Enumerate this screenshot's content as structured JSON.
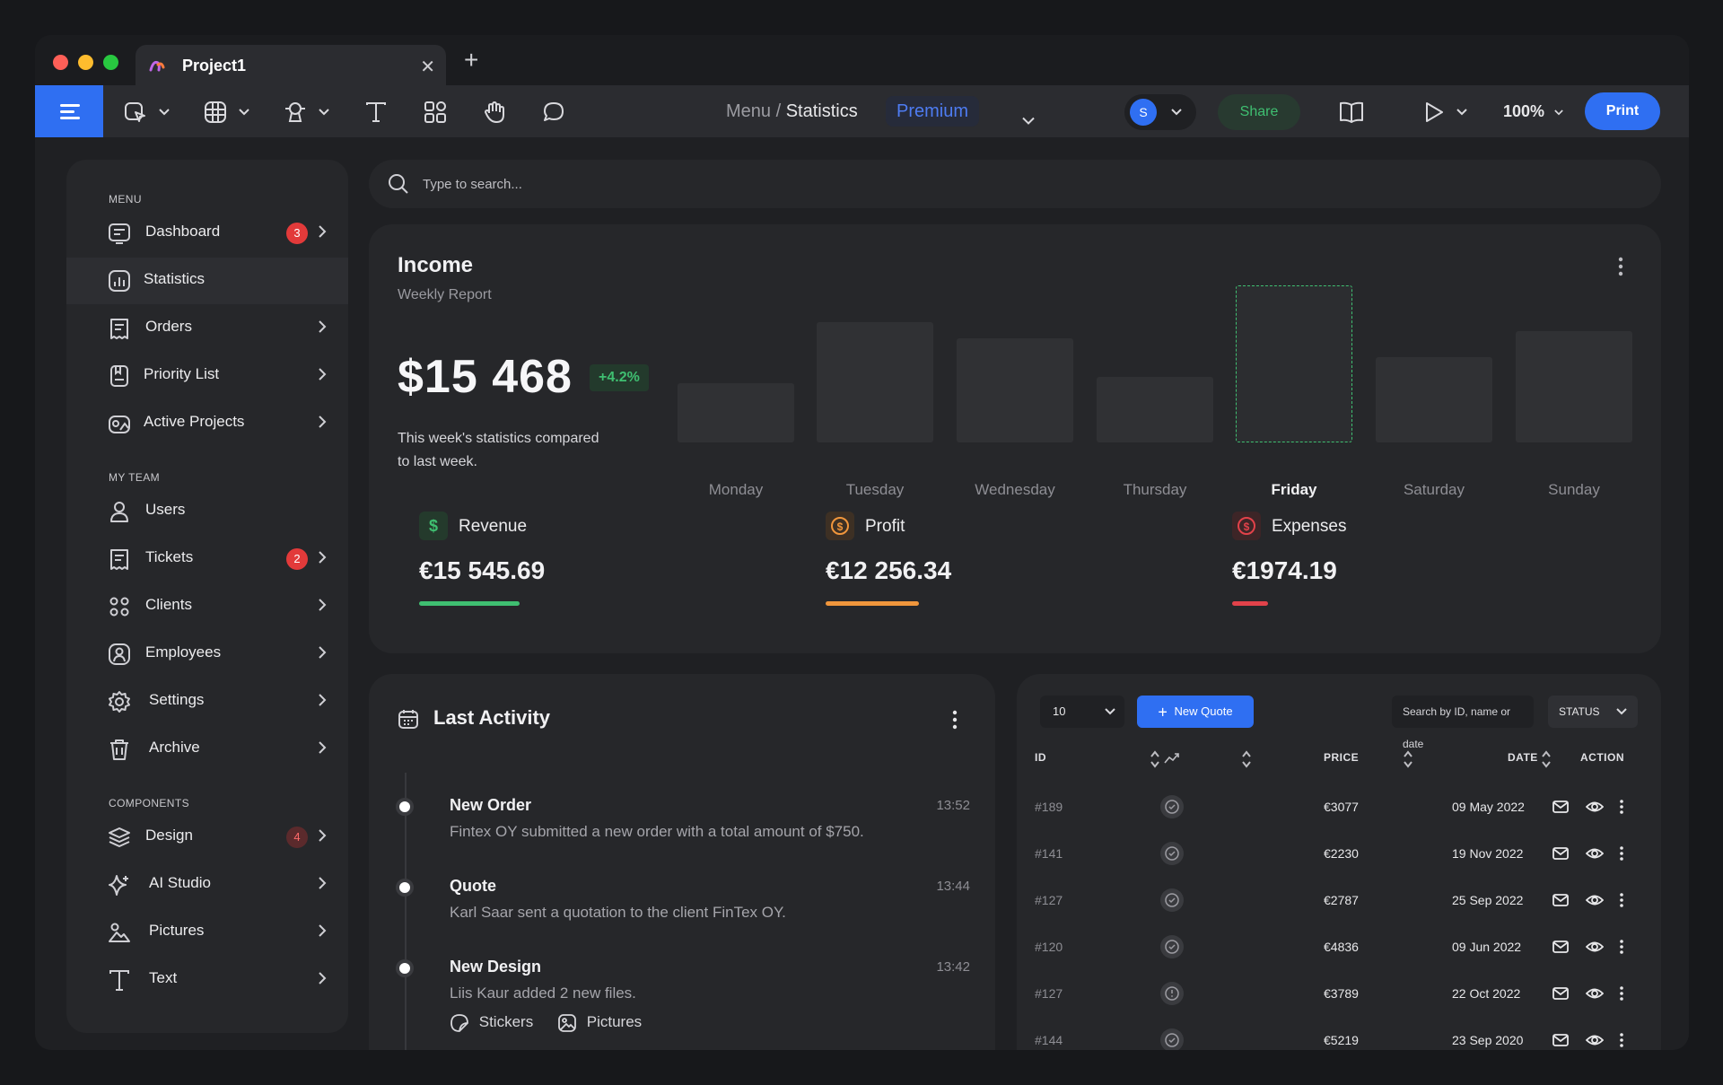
{
  "tab": {
    "title": "Project1"
  },
  "breadcrumb": {
    "parent": "Menu",
    "separator": "/",
    "current": "Statistics",
    "plan": "Premium"
  },
  "user": {
    "initial": "S"
  },
  "toolbar": {
    "share_label": "Share",
    "zoom": "100%",
    "print_label": "Print"
  },
  "sidebar": {
    "sections": [
      "MENU",
      "MY TEAM",
      "COMPONENTS"
    ],
    "items": [
      {
        "label": "Dashboard",
        "badge": "3"
      },
      {
        "label": "Statistics"
      },
      {
        "label": "Orders"
      },
      {
        "label": "Priority List"
      },
      {
        "label": "Active Projects"
      },
      {
        "label": "Users"
      },
      {
        "label": "Tickets",
        "badge": "2"
      },
      {
        "label": "Clients"
      },
      {
        "label": "Employees"
      },
      {
        "label": "Settings"
      },
      {
        "label": "Archive"
      },
      {
        "label": "Design",
        "badge": "4"
      },
      {
        "label": "AI Studio"
      },
      {
        "label": "Pictures"
      },
      {
        "label": "Text"
      }
    ]
  },
  "search": {
    "placeholder": "Type to search..."
  },
  "income": {
    "title": "Income",
    "subtitle": "Weekly Report",
    "total": "$15 468",
    "change": "+4.2%",
    "description": "This week's statistics compared to last week.",
    "days": [
      "Monday",
      "Tuesday",
      "Wednesday",
      "Thursday",
      "Friday",
      "Saturday",
      "Sunday"
    ],
    "highlight_day": "Friday",
    "metrics": [
      {
        "label": "Revenue",
        "value": "€15 545.69",
        "color": "#3fbf71"
      },
      {
        "label": "Profit",
        "value": "€12 256.34",
        "color": "#f0963c"
      },
      {
        "label": "Expenses",
        "value": "€1974.19",
        "color": "#e2424a"
      }
    ]
  },
  "activity": {
    "title": "Last Activity",
    "events": [
      {
        "title": "New Order",
        "desc": "Fintex OY submitted a new order with a total amount of $750.",
        "time": "13:52"
      },
      {
        "title": "Quote",
        "desc": "Karl Saar sent a quotation to the client FinTex OY.",
        "time": "13:44"
      },
      {
        "title": "New Design",
        "desc": "Liis Kaur added 2 new files.",
        "time": "13:42"
      }
    ],
    "attachments": [
      "Stickers",
      "Pictures"
    ]
  },
  "table": {
    "page_size": "10",
    "new_label": "New Quote",
    "search_placeholder": "Search by ID, name or date",
    "status_label": "STATUS",
    "headers": {
      "id": "ID",
      "price": "PRICE",
      "date": "DATE",
      "action": "ACTION"
    },
    "rows": [
      {
        "id": "#189",
        "price": "€3077",
        "date": "09 May 2022"
      },
      {
        "id": "#141",
        "price": "€2230",
        "date": "19 Nov 2022"
      },
      {
        "id": "#127",
        "price": "€2787",
        "date": "25 Sep 2022"
      },
      {
        "id": "#120",
        "price": "€4836",
        "date": "09 Jun 2022"
      },
      {
        "id": "#127",
        "price": "€3789",
        "date": "22 Oct 2022"
      },
      {
        "id": "#144",
        "price": "€5219",
        "date": "23 Sep 2020"
      }
    ]
  }
}
